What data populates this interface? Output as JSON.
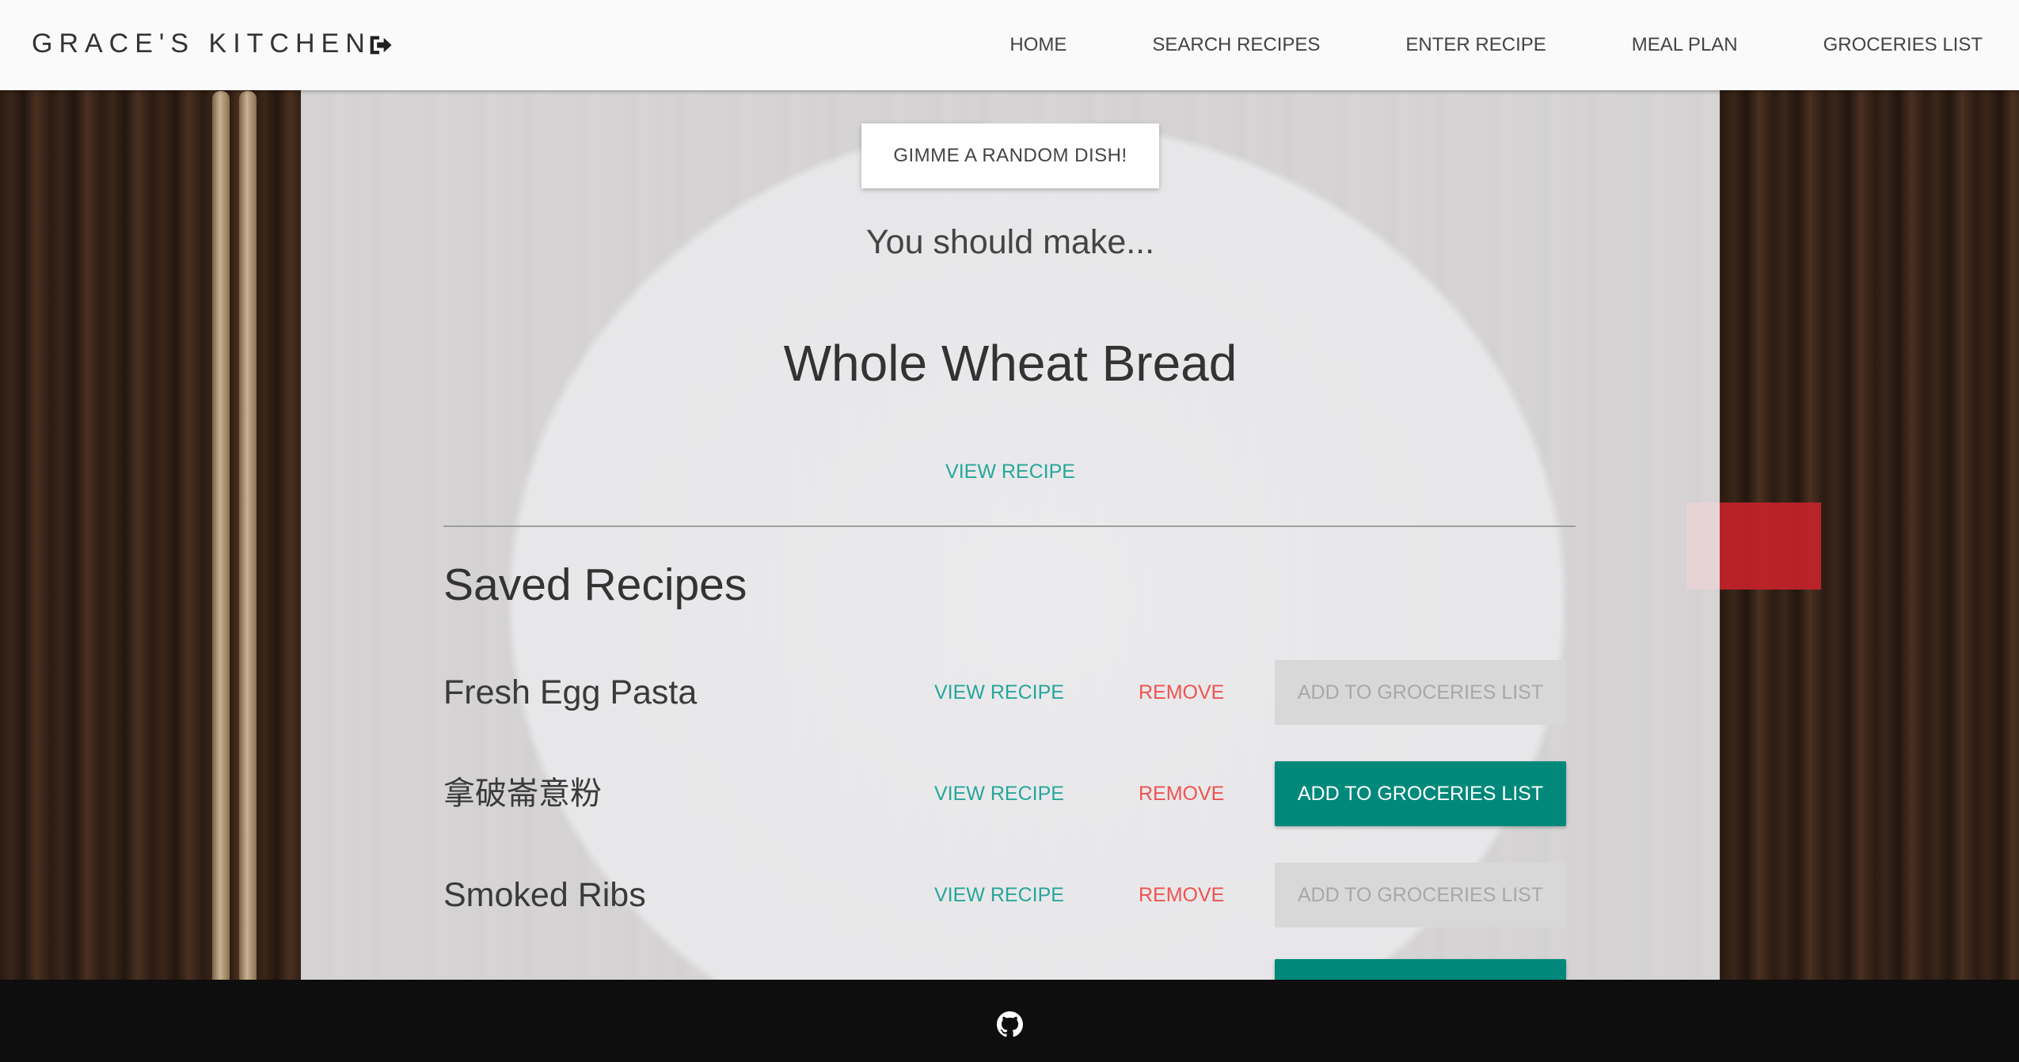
{
  "navbar": {
    "brand": "GRACE'S KITCHEN",
    "logout_icon": "sign-out-icon",
    "links": [
      "HOME",
      "SEARCH RECIPES",
      "ENTER RECIPE",
      "MEAL PLAN",
      "GROCERIES LIST"
    ]
  },
  "random": {
    "button_label": "GIMME A RANDOM DISH!",
    "prompt": "You should make...",
    "dish": "Whole Wheat Bread",
    "view_label": "VIEW RECIPE"
  },
  "saved": {
    "title": "Saved Recipes",
    "rows": [
      {
        "name": "Fresh Egg Pasta",
        "view": "VIEW RECIPE",
        "remove": "REMOVE",
        "add": "ADD TO GROCERIES LIST",
        "add_enabled": false
      },
      {
        "name": "拿破崙意粉",
        "view": "VIEW RECIPE",
        "remove": "REMOVE",
        "add": "ADD TO GROCERIES LIST",
        "add_enabled": true
      },
      {
        "name": "Smoked Ribs",
        "view": "VIEW RECIPE",
        "remove": "REMOVE",
        "add": "ADD TO GROCERIES LIST",
        "add_enabled": false
      },
      {
        "name": "",
        "view": "",
        "remove": "",
        "add": "",
        "add_enabled": true
      }
    ]
  },
  "footer": {
    "icon": "github-icon"
  },
  "colors": {
    "accent_teal": "#26a69a",
    "button_teal": "#00897b",
    "remove_red": "#ef5350",
    "disabled_gray": "#d8d8d8"
  }
}
